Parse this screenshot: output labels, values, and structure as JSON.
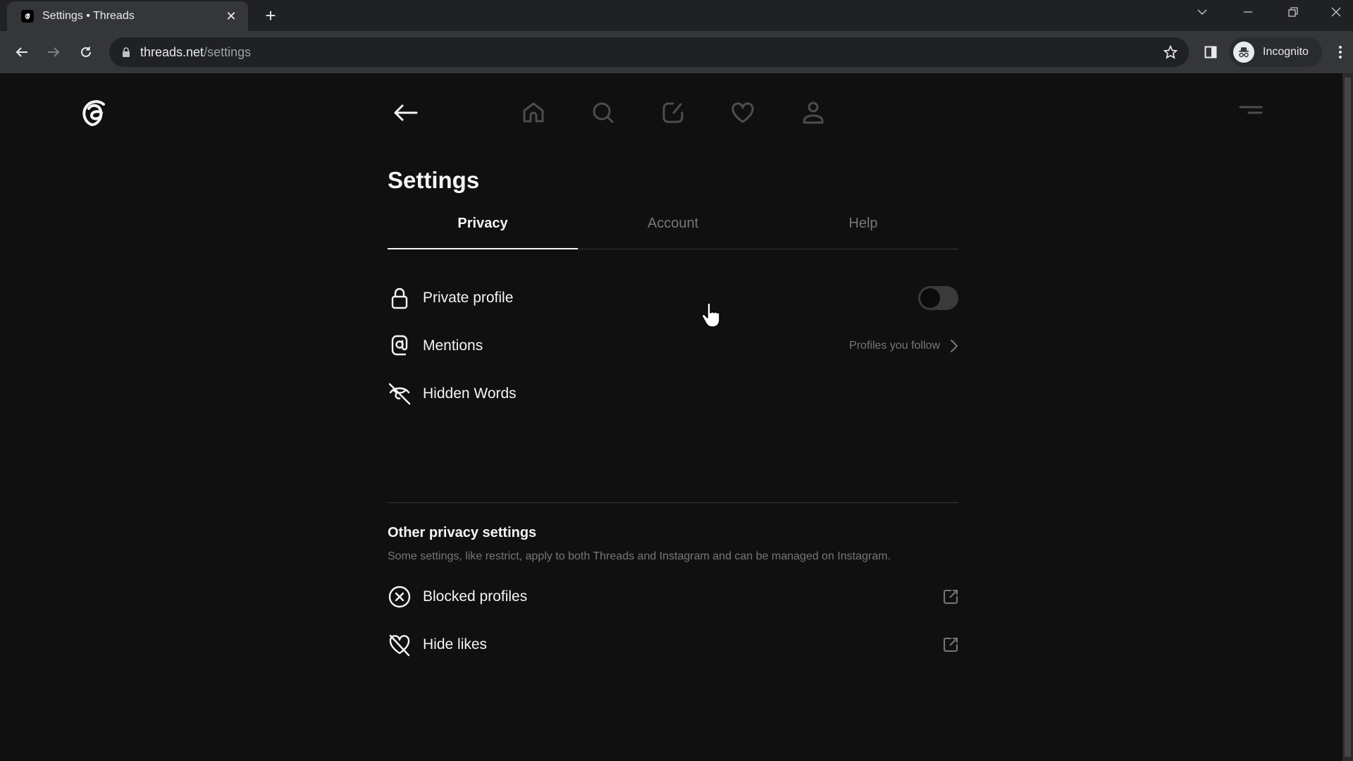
{
  "browser": {
    "tab_title": "Settings • Threads",
    "url_host": "threads.net",
    "url_path": "/settings",
    "profile_label": "Incognito"
  },
  "header": {
    "nav_icons": [
      "home-icon",
      "search-icon",
      "create-icon",
      "heart-icon",
      "profile-icon"
    ]
  },
  "settings": {
    "title": "Settings",
    "tabs": [
      {
        "label": "Privacy",
        "active": true
      },
      {
        "label": "Account",
        "active": false
      },
      {
        "label": "Help",
        "active": false
      }
    ],
    "privacy_items": [
      {
        "label": "Private profile",
        "icon": "lock-icon",
        "toggle_on": false
      },
      {
        "label": "Mentions",
        "icon": "at-icon",
        "value": "Profiles you follow"
      },
      {
        "label": "Hidden Words",
        "icon": "eye-off-icon"
      }
    ],
    "other_section": {
      "title": "Other privacy settings",
      "description": "Some settings, like restrict, apply to both Threads and Instagram and can be managed on Instagram.",
      "items": [
        {
          "label": "Blocked profiles",
          "icon": "blocked-icon"
        },
        {
          "label": "Hide likes",
          "icon": "heart-off-icon"
        }
      ]
    }
  },
  "colors": {
    "background": "#101010",
    "text_primary": "#f3f5f7",
    "text_secondary": "#777777"
  }
}
